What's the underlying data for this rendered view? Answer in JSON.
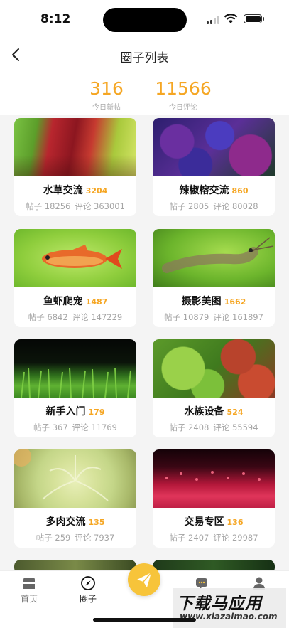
{
  "status_bar": {
    "time": "8:12"
  },
  "nav": {
    "title": "圈子列表"
  },
  "stats": [
    {
      "value": "316",
      "label": "今日新帖"
    },
    {
      "value": "11566",
      "label": "今日评论"
    }
  ],
  "circles": [
    {
      "name": "水草交流",
      "count": "3204",
      "posts": "帖子 18256",
      "comments": "评论 363001"
    },
    {
      "name": "辣椒榕交流",
      "count": "860",
      "posts": "帖子 2805",
      "comments": "评论 80028"
    },
    {
      "name": "鱼虾爬宠",
      "count": "1487",
      "posts": "帖子 6842",
      "comments": "评论 147229"
    },
    {
      "name": "摄影美图",
      "count": "1662",
      "posts": "帖子 10879",
      "comments": "评论 161897"
    },
    {
      "name": "新手入门",
      "count": "179",
      "posts": "帖子 367",
      "comments": "评论 11769"
    },
    {
      "name": "水族设备",
      "count": "524",
      "posts": "帖子 2408",
      "comments": "评论 55594"
    },
    {
      "name": "多肉交流",
      "count": "135",
      "posts": "帖子 259",
      "comments": "评论 7937"
    },
    {
      "name": "交易专区",
      "count": "136",
      "posts": "帖子 2407",
      "comments": "评论 29987"
    }
  ],
  "tabbar": {
    "home": "首页",
    "circle": "圈子"
  },
  "watermark": {
    "logo": "下载马应用",
    "url": "www.xiazaimao.com"
  },
  "colors": {
    "accent": "#f5a623",
    "fab": "#f7c43a"
  }
}
